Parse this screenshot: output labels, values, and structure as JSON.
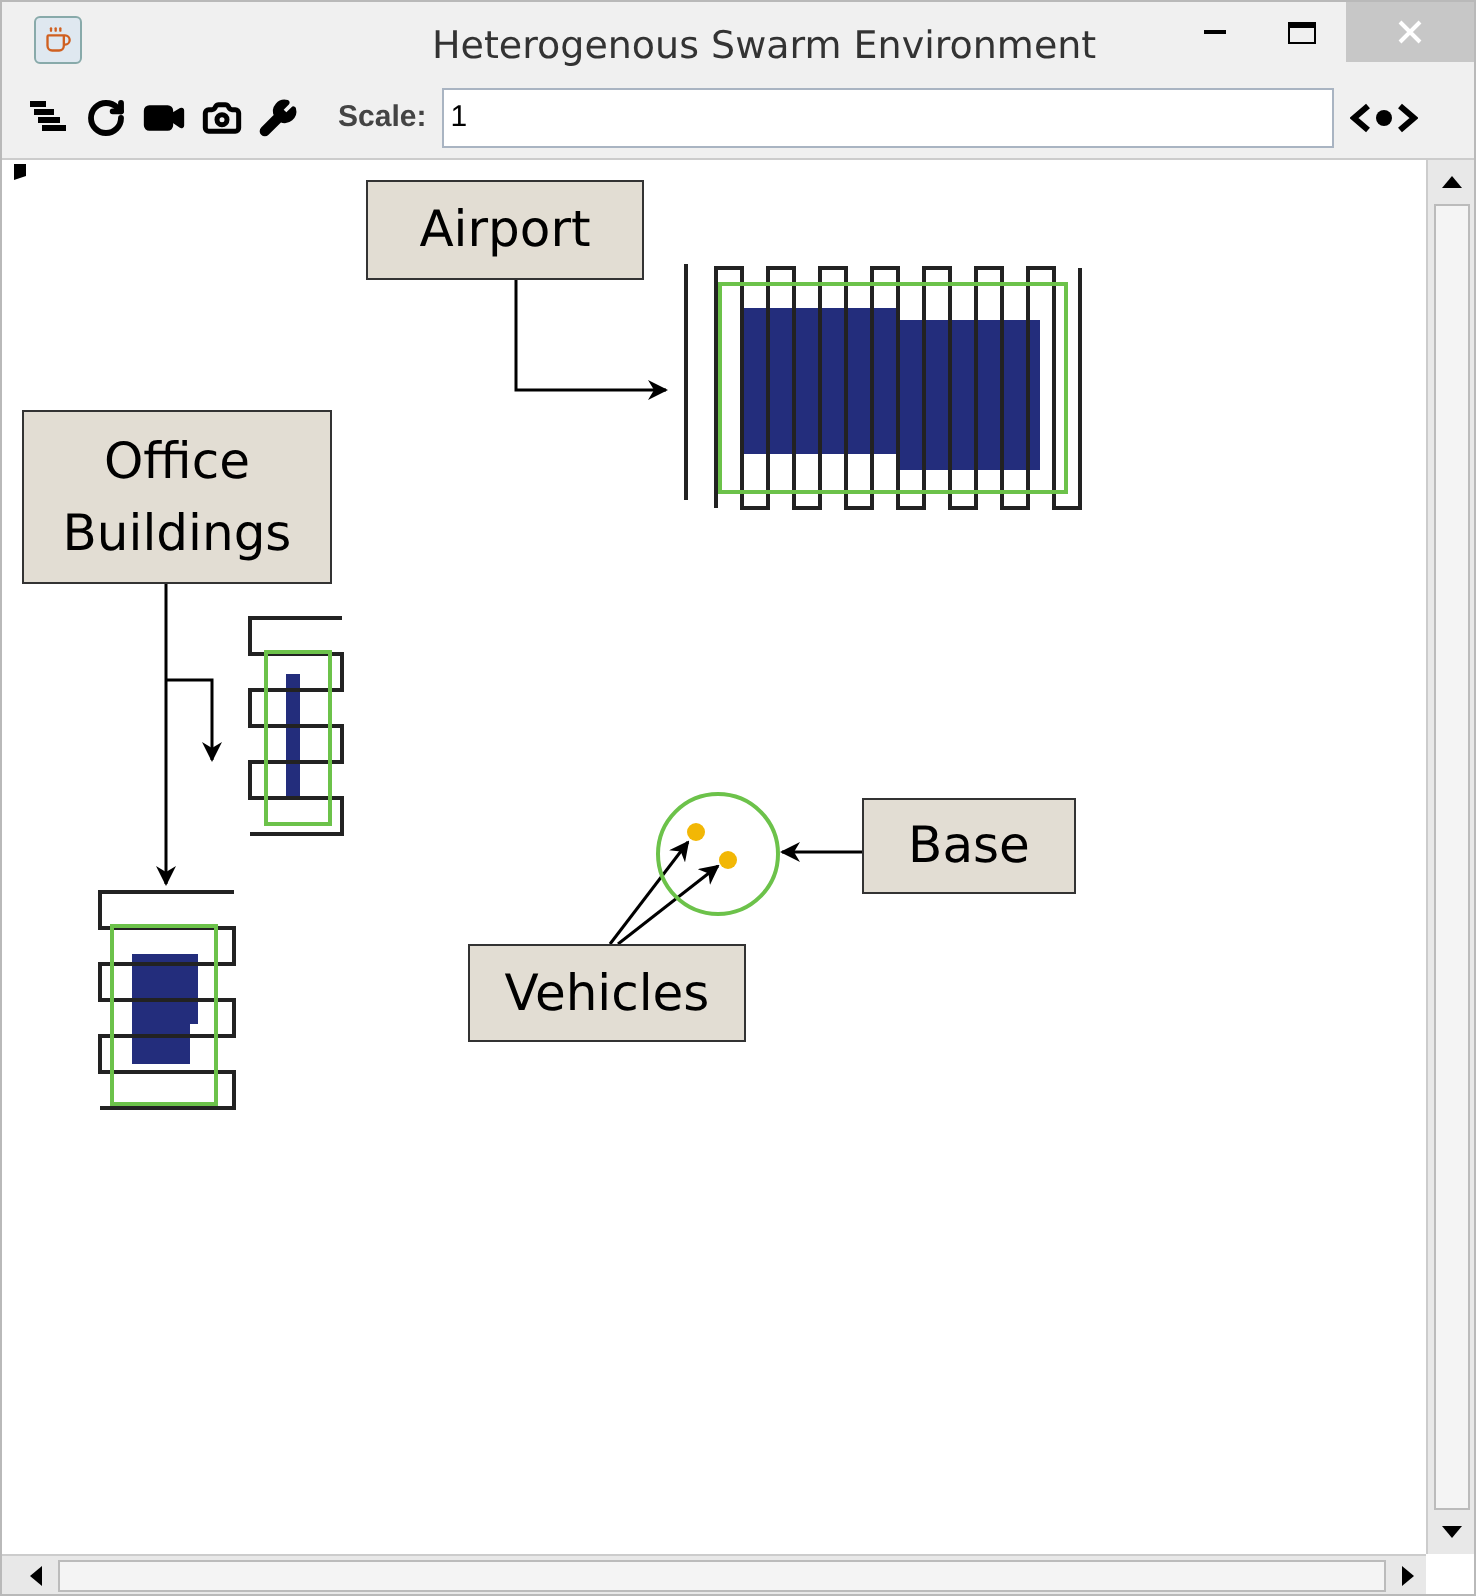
{
  "window": {
    "title": "Heterogenous Swarm Environment"
  },
  "toolbar": {
    "scale_label": "Scale:",
    "scale_value": "1"
  },
  "callouts": [
    {
      "kind": "airport",
      "text": "Airport"
    },
    {
      "kind": "offices",
      "text": "Office Buildings"
    },
    {
      "kind": "base",
      "text": "Base"
    },
    {
      "kind": "vehicles",
      "text": "Vehicles"
    }
  ]
}
